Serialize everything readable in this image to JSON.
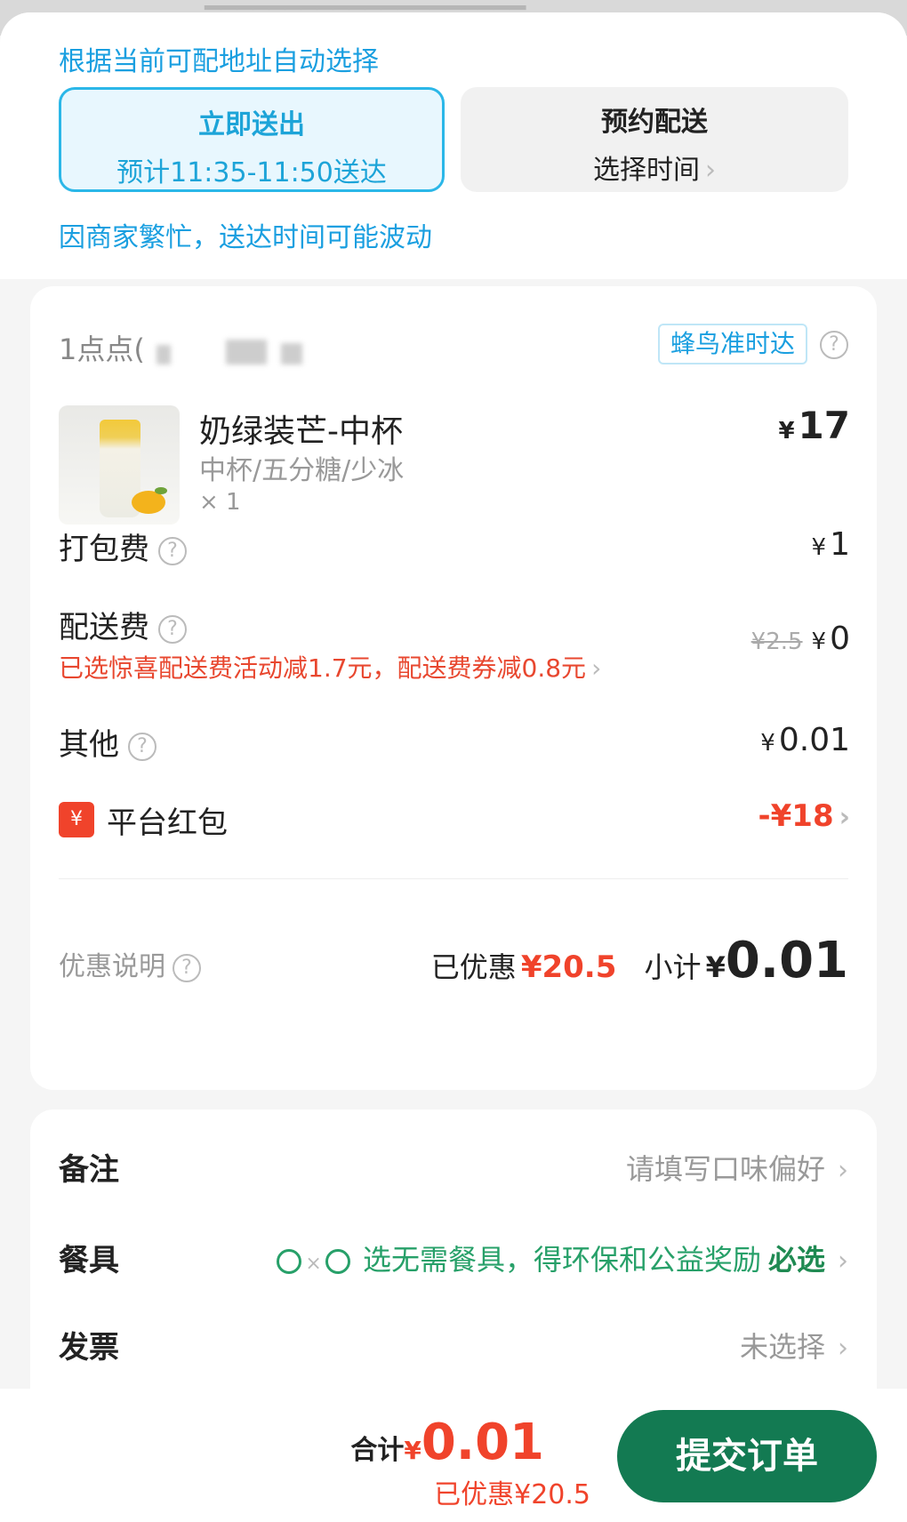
{
  "delivery": {
    "auto_hint": "根据当前可配地址自动选择",
    "now_title": "立即送出",
    "now_eta": "预计11:35-11:50送达",
    "later_title": "预约配送",
    "later_sub": "选择时间",
    "busy_note": "因商家繁忙，送达时间可能波动"
  },
  "store": {
    "name": "1点点(",
    "badge": "蜂鸟准时达"
  },
  "product": {
    "name": "奶绿装芒-中杯",
    "spec": "中杯/五分糖/少冰",
    "qty": "× 1",
    "currency": "¥",
    "price": "17"
  },
  "fees": {
    "packing_label": "打包费",
    "packing_price": "1",
    "shipping_label": "配送费",
    "shipping_promo": "已选惊喜配送费活动减1.7元，配送费券减0.8元",
    "shipping_original": "¥2.5",
    "shipping_price": "0",
    "other_label": "其他",
    "other_price": "0.01",
    "redpack_icon": "¥",
    "redpack_label": "平台红包",
    "redpack_value": "-¥18"
  },
  "summary": {
    "discount_label": "优惠说明",
    "saved_label": "已优惠",
    "saved_value": "¥20.5",
    "subtotal_label": "小计",
    "subtotal_yen": "¥",
    "subtotal_value": "0.01"
  },
  "extras": {
    "note_label": "备注",
    "note_placeholder": "请填写口味偏好",
    "utensils_label": "餐具",
    "utensils_text": "选无需餐具，得环保和公益奖励",
    "utensils_required": "必选",
    "invoice_label": "发票",
    "invoice_value": "未选择"
  },
  "footer": {
    "total_label": "合计",
    "total_yen": "¥",
    "total_value": "0.01",
    "total_saved": "已优惠¥20.5",
    "submit_label": "提交订单"
  },
  "colors": {
    "accent_blue": "#1a9fe0",
    "discount_red": "#f0432b",
    "submit_green": "#137a52"
  }
}
